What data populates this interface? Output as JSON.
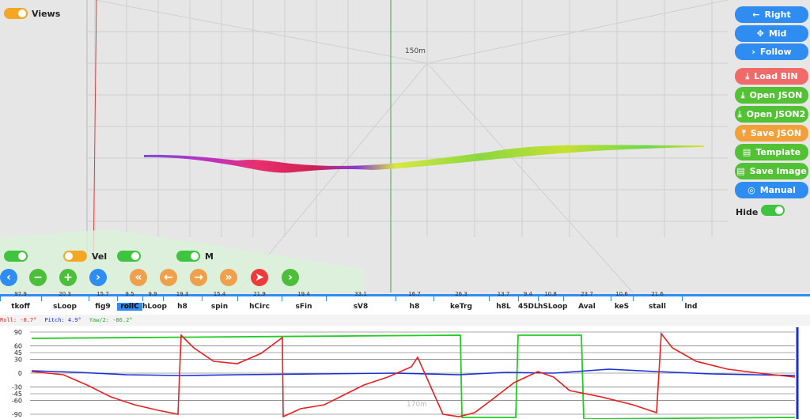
{
  "viewport": {
    "views_label": "Views",
    "altitude_label": "150m",
    "vel_label": "Vel",
    "m_label": "M",
    "hide_label": "Hide"
  },
  "side_buttons": [
    {
      "key": "right",
      "label": "Right",
      "icon": "arrow-left-icon",
      "color": "#2f8cf0"
    },
    {
      "key": "mid",
      "label": "Mid",
      "icon": "move-icon",
      "color": "#2f8cf0"
    },
    {
      "key": "follow",
      "label": "Follow",
      "icon": "chevron-right-icon",
      "color": "#2f8cf0"
    },
    {
      "key": "load_bin",
      "label": "Load BIN",
      "icon": "download-icon",
      "color": "#f06a6a"
    },
    {
      "key": "open_json",
      "label": "Open JSON",
      "icon": "download-icon",
      "color": "#52c234"
    },
    {
      "key": "open_json2",
      "label": "Open JSON2",
      "icon": "download-icon",
      "color": "#52c234"
    },
    {
      "key": "save_json",
      "label": "Save JSON",
      "icon": "upload-icon",
      "color": "#f2a03a"
    },
    {
      "key": "template",
      "label": "Template",
      "icon": "document-icon",
      "color": "#52c234"
    },
    {
      "key": "save_image",
      "label": "Save Image",
      "icon": "document-icon",
      "color": "#52c234"
    },
    {
      "key": "manual",
      "label": "Manual",
      "icon": "lifebuoy-icon",
      "color": "#2f8cf0"
    }
  ],
  "timeline": {
    "segments": [
      {
        "name": "tkoff",
        "dur": "97.9"
      },
      {
        "name": "sLoop",
        "dur": "20.3"
      },
      {
        "name": "fig9",
        "dur": "15.7"
      },
      {
        "name": "rollC",
        "dur": "9.5",
        "selected": true
      },
      {
        "name": "hLoop",
        "dur": "9.9"
      },
      {
        "name": "h8",
        "dur": "19.3"
      },
      {
        "name": "spin",
        "dur": "15.4"
      },
      {
        "name": "hCirc",
        "dur": "21.9"
      },
      {
        "name": "sFin",
        "dur": "19.4"
      },
      {
        "name": "sV8",
        "dur": "33.1"
      },
      {
        "name": "h8",
        "dur": "16.7"
      },
      {
        "name": "keTrg",
        "dur": "26.3"
      },
      {
        "name": "h8L",
        "dur": "13.7"
      },
      {
        "name": "45DL",
        "dur": "9.4"
      },
      {
        "name": "hSLoop",
        "dur": "10.8"
      },
      {
        "name": "Aval",
        "dur": "23.7"
      },
      {
        "name": "keS",
        "dur": "10.6"
      },
      {
        "name": "stall",
        "dur": "21.6"
      },
      {
        "name": "lnd",
        "dur": ""
      }
    ]
  },
  "readout": {
    "roll": "Roll: -0.7°",
    "pitch": "Pitch: 4.9°",
    "yaw": "Yaw/2: -86.2°"
  },
  "graph": {
    "y_ticks": [
      "90",
      "60",
      "45",
      "30",
      "0",
      "-30",
      "-45",
      "-60",
      "-90"
    ],
    "bg_label": "170m"
  },
  "colors": {
    "roll": "#e82020",
    "pitch": "#1a2fd8",
    "yaw": "#22cc22",
    "accent": "#2f8cf0"
  }
}
